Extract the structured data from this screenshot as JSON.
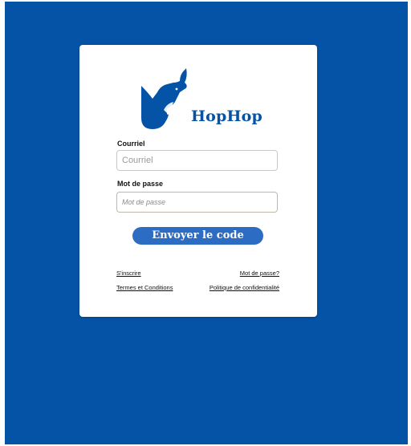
{
  "brand": {
    "name": "HopHop",
    "color": "#0553a6"
  },
  "login": {
    "email_label": "Courriel",
    "email_placeholder": "Courriel",
    "email_value": "",
    "password_label": "Mot de passe",
    "password_placeholder": "Mot de passe",
    "password_value": "",
    "submit_label": "Envoyer le code"
  },
  "links": {
    "signup": "S'inscrire",
    "forgot_password": "Mot de passe?",
    "terms": "Termes et Conditions",
    "privacy": "Politique de confidentialité"
  },
  "colors": {
    "page_background": "#0553a6",
    "card_background": "#ffffff",
    "button": "#2c6cc2"
  },
  "icons": {
    "logo": "rabbit-logo-icon"
  }
}
